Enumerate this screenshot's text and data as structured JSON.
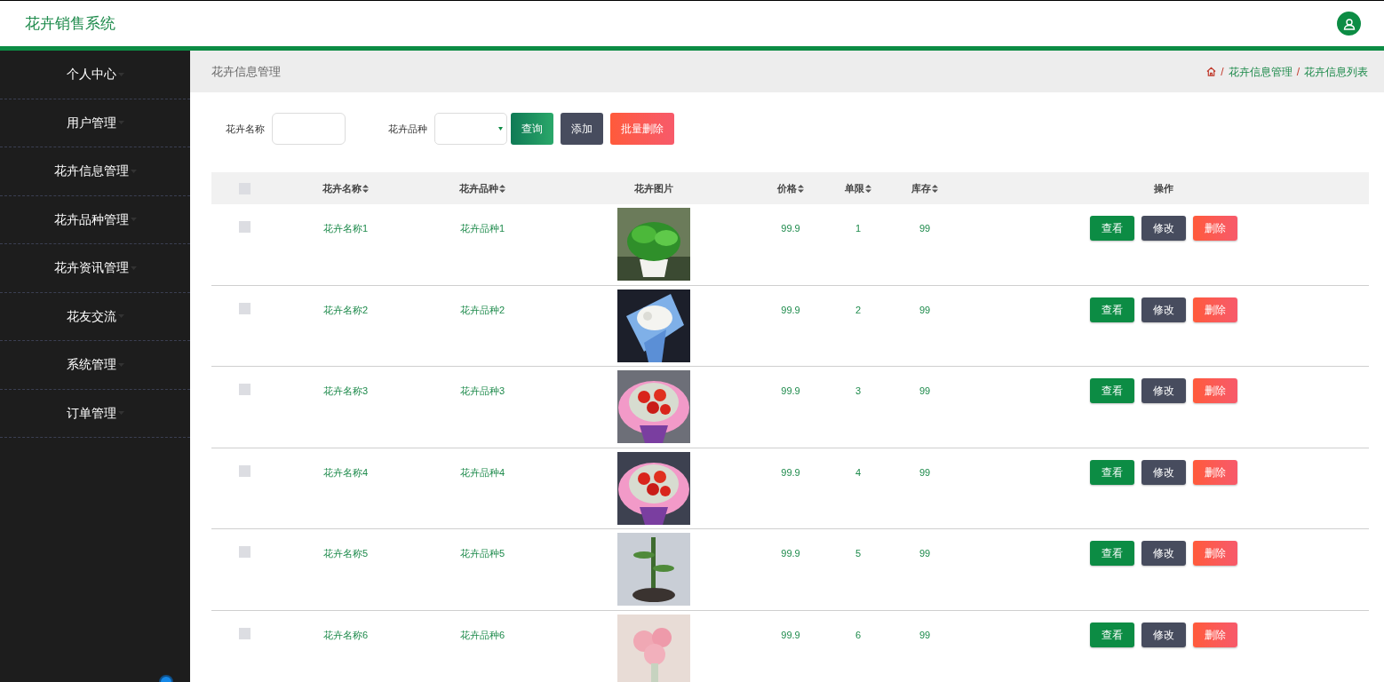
{
  "app_title": "花卉销售系统",
  "sidebar": {
    "items": [
      {
        "label": "个人中心",
        "selected": false
      },
      {
        "label": "用户管理",
        "selected": false
      },
      {
        "label": "花卉信息管理",
        "selected": false
      },
      {
        "label": "花卉品种管理",
        "selected": false
      },
      {
        "label": "花卉资讯管理",
        "selected": false
      },
      {
        "label": "花友交流",
        "selected": false
      },
      {
        "label": "系统管理",
        "selected": false
      },
      {
        "label": "订单管理",
        "selected": false
      }
    ]
  },
  "page_title": "花卉信息管理",
  "breadcrumb": [
    {
      "separator": "/",
      "label": "花卉信息管理"
    },
    {
      "separator": "/",
      "label": "花卉信息列表"
    }
  ],
  "search": {
    "fields": [
      {
        "label": "花卉名称",
        "kind": "text"
      },
      {
        "label": "花卉品种",
        "kind": "select"
      }
    ],
    "buttons": [
      {
        "label": "查询",
        "kind": "search"
      },
      {
        "label": "添加",
        "kind": "add"
      },
      {
        "label": "批量删除",
        "kind": "delete"
      }
    ]
  },
  "table": {
    "select_all": {
      "checked": false
    },
    "columns": [
      {
        "label": "花卉名称",
        "sortable": true
      },
      {
        "label": "花卉品种",
        "sortable": true
      },
      {
        "label": "花卉图片",
        "sortable": false
      },
      {
        "label": "价格",
        "sortable": true
      },
      {
        "label": "单限",
        "sortable": true
      },
      {
        "label": "库存",
        "sortable": true
      },
      {
        "label": "操作",
        "sortable": false
      }
    ],
    "rows": [
      {
        "checked": false,
        "name": "花卉名称1",
        "variety": "花卉品种1",
        "price": "99.9",
        "limit": "1",
        "stock": "99",
        "actions": [
          {
            "label": "查看",
            "kind": "view"
          },
          {
            "label": "修改",
            "kind": "edit"
          },
          {
            "label": "删除",
            "kind": "delete"
          }
        ]
      },
      {
        "checked": false,
        "name": "花卉名称2",
        "variety": "花卉品种2",
        "price": "99.9",
        "limit": "2",
        "stock": "99",
        "actions": [
          {
            "label": "查看",
            "kind": "view"
          },
          {
            "label": "修改",
            "kind": "edit"
          },
          {
            "label": "删除",
            "kind": "delete"
          }
        ]
      },
      {
        "checked": false,
        "name": "花卉名称3",
        "variety": "花卉品种3",
        "price": "99.9",
        "limit": "3",
        "stock": "99",
        "actions": [
          {
            "label": "查看",
            "kind": "view"
          },
          {
            "label": "修改",
            "kind": "edit"
          },
          {
            "label": "删除",
            "kind": "delete"
          }
        ]
      },
      {
        "checked": false,
        "name": "花卉名称4",
        "variety": "花卉品种4",
        "price": "99.9",
        "limit": "4",
        "stock": "99",
        "actions": [
          {
            "label": "查看",
            "kind": "view"
          },
          {
            "label": "修改",
            "kind": "edit"
          },
          {
            "label": "删除",
            "kind": "delete"
          }
        ]
      },
      {
        "checked": false,
        "name": "花卉名称5",
        "variety": "花卉品种5",
        "price": "99.9",
        "limit": "5",
        "stock": "99",
        "actions": [
          {
            "label": "查看",
            "kind": "view"
          },
          {
            "label": "修改",
            "kind": "edit"
          },
          {
            "label": "删除",
            "kind": "delete"
          }
        ]
      },
      {
        "checked": false,
        "name": "花卉名称6",
        "variety": "花卉品种6",
        "price": "99.9",
        "limit": "6",
        "stock": "99",
        "actions": [
          {
            "label": "查看",
            "kind": "view"
          },
          {
            "label": "修改",
            "kind": "edit"
          },
          {
            "label": "删除",
            "kind": "delete"
          }
        ]
      }
    ]
  }
}
